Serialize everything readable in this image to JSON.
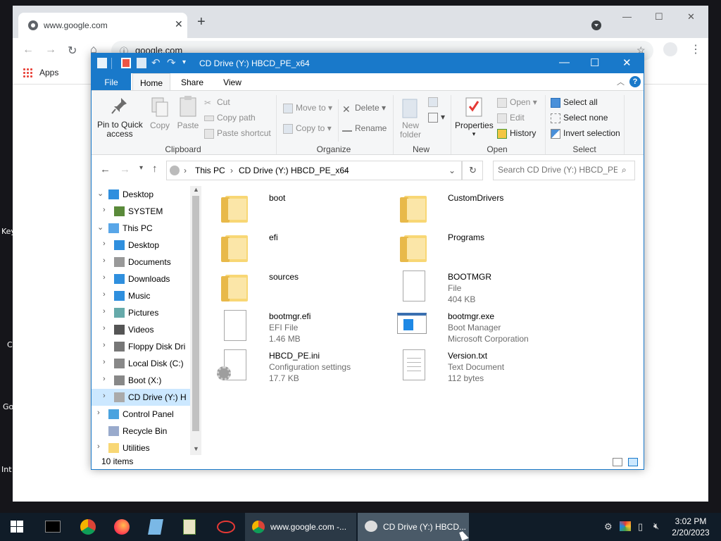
{
  "desktop": {
    "side_labels": [
      "Key",
      "C",
      "Go",
      "Int"
    ]
  },
  "chrome": {
    "tab_title": "www.google.com",
    "url": "google.com",
    "bookmarks_apps_label": "Apps"
  },
  "explorer": {
    "title": "CD Drive (Y:) HBCD_PE_x64",
    "ribbon_tabs": {
      "file": "File",
      "home": "Home",
      "share": "Share",
      "view": "View"
    },
    "clipboard": {
      "pin": "Pin to Quick access",
      "pin_line1": "Pin to Quick",
      "pin_line2": "access",
      "copy": "Copy",
      "paste": "Paste",
      "cut": "Cut",
      "copy_path": "Copy path",
      "paste_shortcut": "Paste shortcut",
      "label": "Clipboard"
    },
    "organize": {
      "move_to": "Move to",
      "copy_to": "Copy to",
      "delete": "Delete",
      "rename": "Rename",
      "label": "Organize"
    },
    "new": {
      "new_folder_line1": "New",
      "new_folder_line2": "folder",
      "label": "New"
    },
    "open": {
      "properties": "Properties",
      "open": "Open",
      "edit": "Edit",
      "history": "History",
      "label": "Open"
    },
    "select": {
      "select_all": "Select all",
      "select_none": "Select none",
      "invert": "Invert selection",
      "label": "Select"
    },
    "address": {
      "crumb1": "This PC",
      "crumb2": "CD Drive (Y:) HBCD_PE_x64"
    },
    "search_placeholder": "Search CD Drive (Y:) HBCD_PE...",
    "nav_tree": [
      {
        "label": "Desktop",
        "expanded": true
      },
      {
        "label": "SYSTEM"
      },
      {
        "label": "This PC",
        "expanded": true
      },
      {
        "label": "Desktop"
      },
      {
        "label": "Documents"
      },
      {
        "label": "Downloads"
      },
      {
        "label": "Music"
      },
      {
        "label": "Pictures"
      },
      {
        "label": "Videos"
      },
      {
        "label": "Floppy Disk Dri"
      },
      {
        "label": "Local Disk (C:)"
      },
      {
        "label": "Boot (X:)"
      },
      {
        "label": "CD Drive (Y:) H",
        "selected": true
      },
      {
        "label": "Control Panel"
      },
      {
        "label": "Recycle Bin"
      },
      {
        "label": "Utilities"
      }
    ],
    "files": [
      {
        "name": "boot",
        "type": "folder"
      },
      {
        "name": "CustomDrivers",
        "type": "folder"
      },
      {
        "name": "efi",
        "type": "folder"
      },
      {
        "name": "Programs",
        "type": "folder"
      },
      {
        "name": "sources",
        "type": "folder"
      },
      {
        "name": "BOOTMGR",
        "meta1": "File",
        "meta2": "404 KB",
        "type": "file"
      },
      {
        "name": "bootmgr.efi",
        "meta1": "EFI File",
        "meta2": "1.46 MB",
        "type": "file"
      },
      {
        "name": "bootmgr.exe",
        "meta1": "Boot Manager",
        "meta2": "Microsoft Corporation",
        "type": "exe"
      },
      {
        "name": "HBCD_PE.ini",
        "meta1": "Configuration settings",
        "meta2": "17.7 KB",
        "type": "ini"
      },
      {
        "name": "Version.txt",
        "meta1": "Text Document",
        "meta2": "112 bytes",
        "type": "txt"
      }
    ],
    "status": "10 items"
  },
  "taskbar": {
    "chrome_window": "www.google.com -...",
    "explorer_window": "CD Drive (Y:) HBCD...",
    "time": "3:02 PM",
    "date": "2/20/2023"
  },
  "colors": {
    "explorer_accent": "#1979ca",
    "selection": "#cce8ff",
    "taskbar": "#101c28",
    "folder": "#f8d775"
  }
}
